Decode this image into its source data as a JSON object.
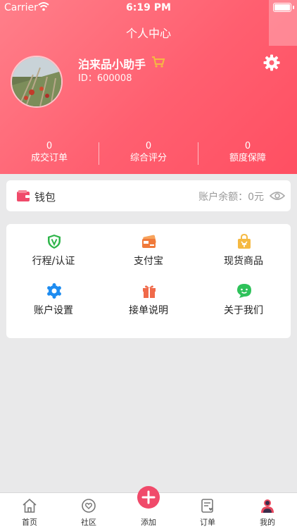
{
  "status_bar": {
    "carrier": "Carrier",
    "time": "6:19 PM"
  },
  "header": {
    "title": "个人中心"
  },
  "profile": {
    "username": "泊来品小助手",
    "user_id": "ID：600008"
  },
  "stats": [
    {
      "value": "0",
      "label": "成交订单"
    },
    {
      "value": "0",
      "label": "综合评分"
    },
    {
      "value": "0",
      "label": "额度保障"
    }
  ],
  "wallet": {
    "label": "钱包",
    "balance": "账户余额：0元"
  },
  "grid": [
    {
      "label": "行程/认证",
      "icon": "shield-v-icon"
    },
    {
      "label": "支付宝",
      "icon": "card-icon"
    },
    {
      "label": "现货商品",
      "icon": "shopping-bag-icon"
    },
    {
      "label": "账户设置",
      "icon": "gear-icon"
    },
    {
      "label": "接单说明",
      "icon": "gift-icon"
    },
    {
      "label": "关于我们",
      "icon": "chat-smile-icon"
    }
  ],
  "tabs": [
    {
      "label": "首页",
      "icon": "home-icon"
    },
    {
      "label": "社区",
      "icon": "community-icon"
    },
    {
      "label": "添加",
      "icon": "plus-icon"
    },
    {
      "label": "订单",
      "icon": "order-icon"
    },
    {
      "label": "我的",
      "icon": "user-icon"
    }
  ],
  "colors": {
    "accent": "#ff5f70",
    "add_button": "#f04a6a",
    "green": "#2eb54a",
    "orange": "#f07a3a",
    "blue": "#1e8cf0"
  }
}
